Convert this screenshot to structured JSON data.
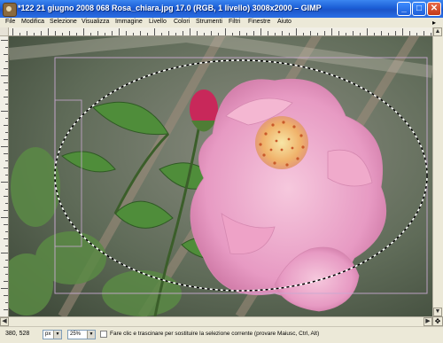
{
  "window": {
    "title": "*122 21 giugno 2008 068 Rosa_chiara.jpg 17.0 (RGB, 1 livello) 3008x2000 – GIMP",
    "controls": {
      "minimize": "_",
      "maximize": "□",
      "close": "✕"
    }
  },
  "menu": [
    {
      "label": "File"
    },
    {
      "label": "Modifica"
    },
    {
      "label": "Selezione"
    },
    {
      "label": "Visualizza"
    },
    {
      "label": "Immagine"
    },
    {
      "label": "Livello"
    },
    {
      "label": "Colori"
    },
    {
      "label": "Strumenti"
    },
    {
      "label": "Filtri"
    },
    {
      "label": "Finestre"
    },
    {
      "label": "Aiuto"
    }
  ],
  "menu_more_arrow": "▸",
  "rulers": {
    "corner_icon": "ruler-corner-icon"
  },
  "canvas": {
    "selection_shape": "ellipse",
    "selection_style": "marching-ants",
    "image_subject": "pink rose"
  },
  "scrollbars": {
    "up": "▲",
    "down": "▼",
    "left": "◀",
    "right": "▶",
    "navigate": "✥"
  },
  "status": {
    "coordinates": "380, 528",
    "unit": "px",
    "zoom": "25%",
    "message": "Fare clic e trascinare per sostituire la selezione corrente (provare Maiusc, Ctrl, Alt)"
  },
  "colors": {
    "titlebar": "#1b5ed6",
    "chrome": "#ece9d8",
    "rose": "#e79ac3"
  }
}
